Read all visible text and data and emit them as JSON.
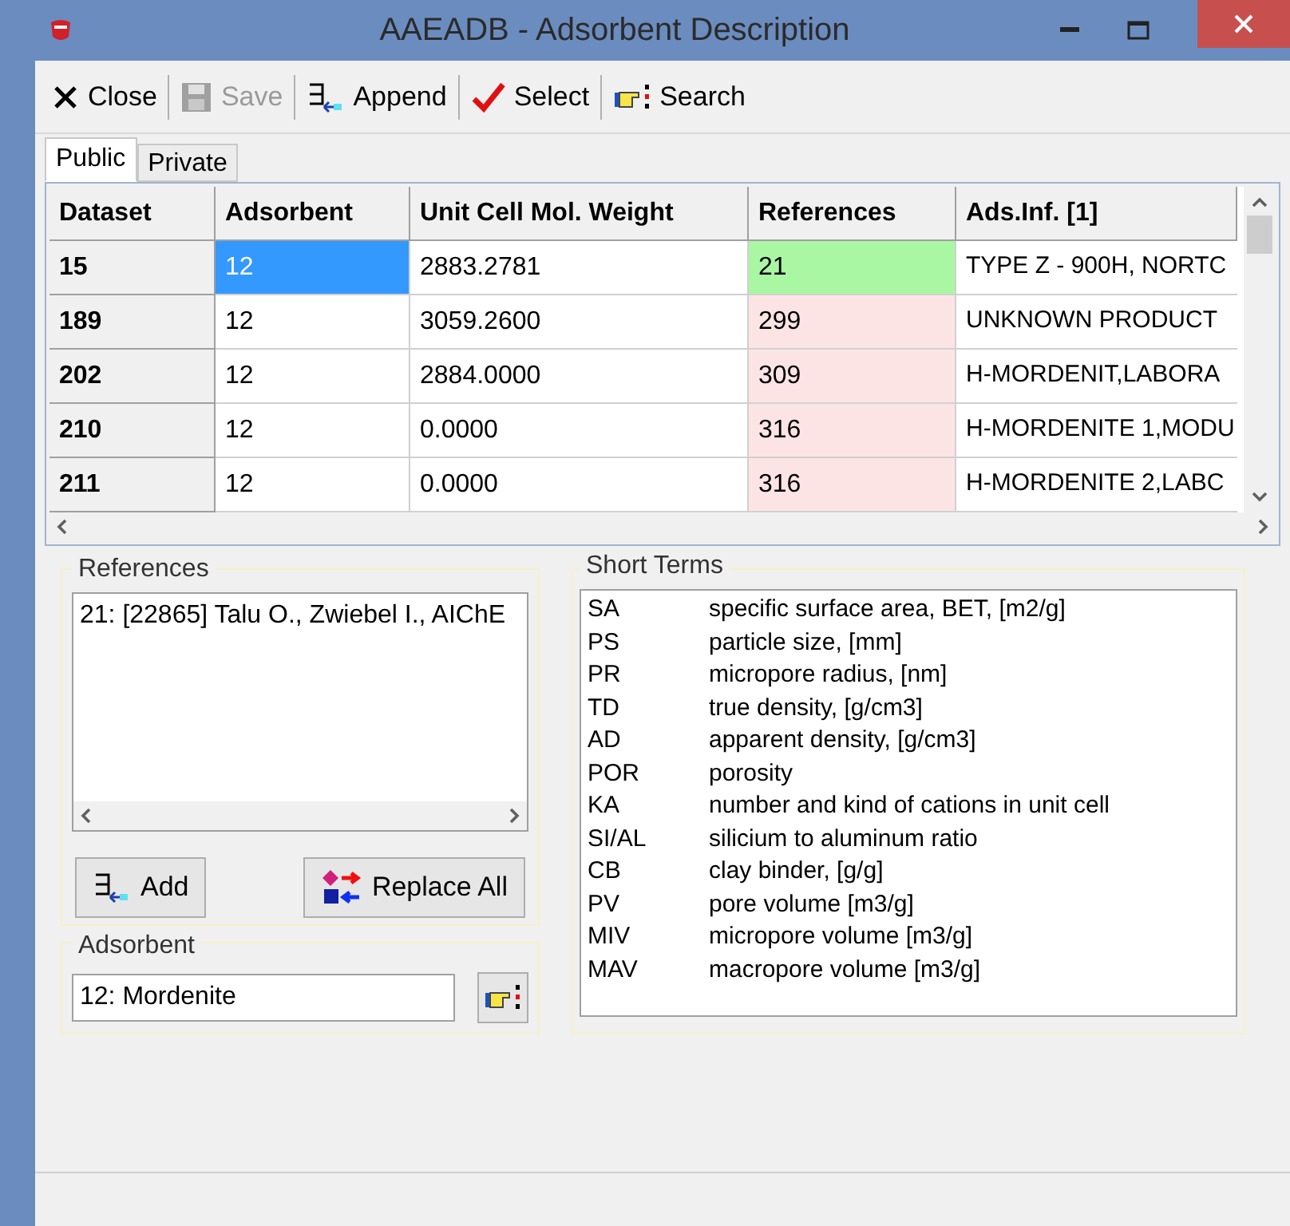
{
  "window": {
    "title": "AAEADB - Adsorbent Description"
  },
  "toolbar": [
    {
      "kind": "close",
      "label": "Close",
      "disabled": false
    },
    {
      "kind": "save",
      "label": "Save",
      "disabled": true
    },
    {
      "kind": "append",
      "label": "Append",
      "disabled": false
    },
    {
      "kind": "select",
      "label": "Select",
      "disabled": false
    },
    {
      "kind": "search",
      "label": "Search",
      "disabled": false
    }
  ],
  "tabs": [
    {
      "label": "Public",
      "selected": true
    },
    {
      "label": "Private",
      "selected": false
    }
  ],
  "table": {
    "columns": [
      "Dataset",
      "Adsorbent",
      "Unit Cell Mol. Weight",
      "References",
      "Ads.Inf. [1]"
    ],
    "rows": [
      {
        "dataset": "15",
        "adsorbent": "12",
        "weight": "2883.2781",
        "references": {
          "text": "21",
          "color": "#a9f7a3"
        },
        "info": "TYPE Z - 900H, NORTC",
        "selected": true
      },
      {
        "dataset": "189",
        "adsorbent": "12",
        "weight": "3059.2600",
        "references": {
          "text": "299",
          "color": "#fde4e4"
        },
        "info": "UNKNOWN PRODUCT",
        "selected": false
      },
      {
        "dataset": "202",
        "adsorbent": "12",
        "weight": "2884.0000",
        "references": {
          "text": "309",
          "color": "#fde4e4"
        },
        "info": "H-MORDENIT,LABORA",
        "selected": false
      },
      {
        "dataset": "210",
        "adsorbent": "12",
        "weight": "0.0000",
        "references": {
          "text": "316",
          "color": "#fde4e4"
        },
        "info": "H-MORDENITE 1,MODU",
        "selected": false
      },
      {
        "dataset": "211",
        "adsorbent": "12",
        "weight": "0.0000",
        "references": {
          "text": "316",
          "color": "#fde4e4"
        },
        "info": "H-MORDENITE 2,LABC",
        "selected": false
      }
    ]
  },
  "references": {
    "title": "References",
    "items": [
      "21: [22865] Talu O., Zwiebel I., AIChE"
    ]
  },
  "buttons": [
    {
      "kind": "add",
      "label": "Add"
    },
    {
      "kind": "replace",
      "label": "Replace All"
    }
  ],
  "adsorbent": {
    "title": "Adsorbent",
    "value": "12: Mordenite"
  },
  "short_terms": {
    "title": "Short Terms",
    "items": [
      {
        "term": "SA",
        "meaning": "specific surface area, BET, [m2/g]"
      },
      {
        "term": "PS",
        "meaning": "particle size, [mm]"
      },
      {
        "term": "PR",
        "meaning": "micropore radius, [nm]"
      },
      {
        "term": "TD",
        "meaning": "true density, [g/cm3]"
      },
      {
        "term": "AD",
        "meaning": "apparent density, [g/cm3]"
      },
      {
        "term": "POR",
        "meaning": "porosity"
      },
      {
        "term": "KA",
        "meaning": "number and kind of cations in unit cell"
      },
      {
        "term": "SI/AL",
        "meaning": "silicium to aluminum ratio"
      },
      {
        "term": "CB",
        "meaning": "clay binder, [g/g]"
      },
      {
        "term": "PV",
        "meaning": "pore volume [m3/g]"
      },
      {
        "term": "MIV",
        "meaning": "micropore volume [m3/g]"
      },
      {
        "term": "MAV",
        "meaning": "macropore volume [m3/g]"
      }
    ]
  }
}
